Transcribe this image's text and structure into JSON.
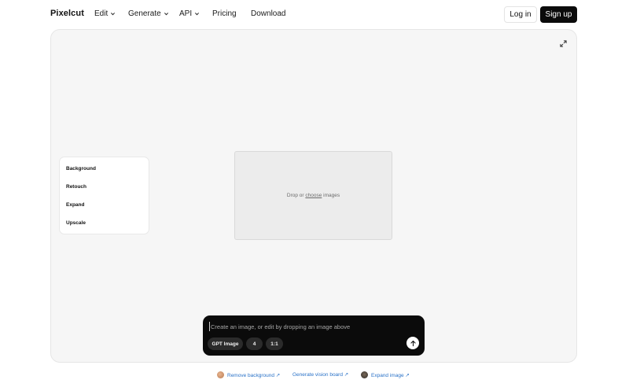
{
  "nav": {
    "logo": "Pixelcut",
    "edit": "Edit",
    "generate": "Generate",
    "api": "API",
    "pricing": "Pricing",
    "download": "Download",
    "login": "Log in",
    "signup": "Sign up"
  },
  "tools": {
    "items": [
      {
        "label": "Background"
      },
      {
        "label": "Retouch"
      },
      {
        "label": "Expand"
      },
      {
        "label": "Upscale"
      }
    ]
  },
  "dropzone": {
    "text_before": "Drop or ",
    "link": "choose",
    "text_after": " images"
  },
  "prompt": {
    "placeholder": "Create an image, or edit by dropping an image above",
    "model_chip": "GPT Image",
    "count_chip": "4",
    "ratio_chip": "1:1"
  },
  "footer": {
    "remove_bg": "Remove background ↗",
    "vision_board": "Generate vision board ↗",
    "expand_image": "Expand image ↗"
  },
  "colors": {
    "canvas_bg": "#f6f6f6",
    "accent_dark": "#0b0b0b",
    "link_blue": "#2a72c8"
  }
}
